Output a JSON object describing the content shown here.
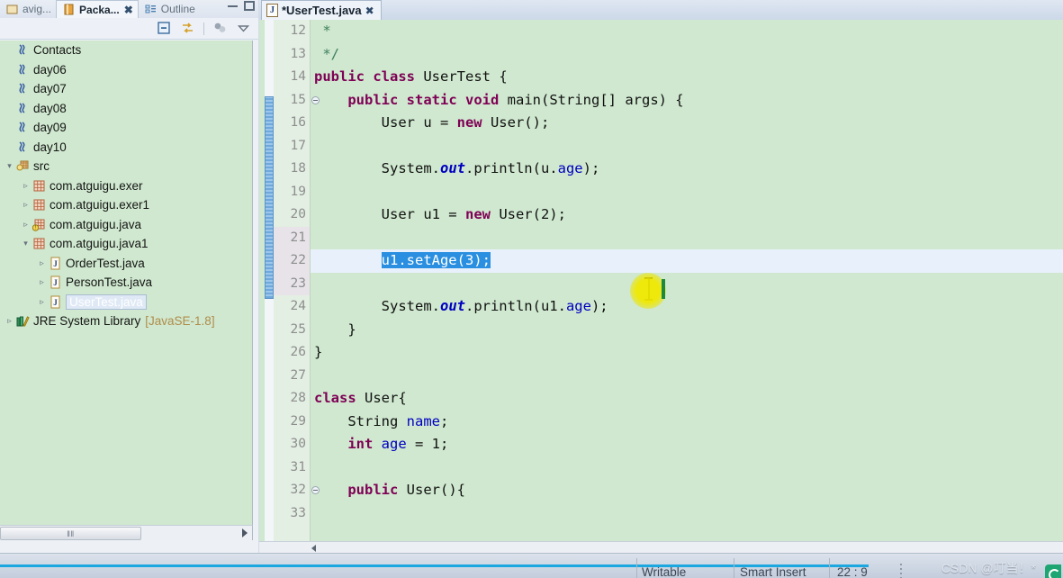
{
  "colors": {
    "tree_bg": "#cfe8cf",
    "editor_bg": "#cfe8cf",
    "selection": "#2a8fe0",
    "keyword": "#7f0055",
    "comment": "#3f7f5f",
    "field": "#0000c0",
    "current_line": "#e8f1fb",
    "accent_cyan": "#1ba8e0"
  },
  "left_panel": {
    "tabs": [
      {
        "label": "avig...",
        "icon": "navigator-icon",
        "active": false,
        "closable": false
      },
      {
        "label": "Packa...",
        "icon": "package-explorer-icon",
        "active": true,
        "closable": true,
        "close": "✖"
      },
      {
        "label": "Outline",
        "icon": "outline-icon",
        "active": false,
        "closable": false
      }
    ],
    "window_buttons": [
      {
        "name": "minimize-button",
        "glyph": "minimize-icon"
      },
      {
        "name": "maximize-button",
        "glyph": "maximize-icon"
      }
    ],
    "toolbar": [
      {
        "name": "collapse-all-icon",
        "title": "Collapse All"
      },
      {
        "name": "link-with-editor-icon",
        "title": "Link with Editor"
      },
      {
        "name": "view-filters-icon",
        "title": "View Menu"
      },
      {
        "name": "chevron-down-icon",
        "title": "View Menu"
      }
    ],
    "tree": [
      {
        "label": "Contacts",
        "indent": 0,
        "icon": "java-project-icon",
        "twisty": "",
        "selected": false,
        "suffix": ""
      },
      {
        "label": "day06",
        "indent": 0,
        "icon": "java-project-icon",
        "twisty": "",
        "selected": false,
        "suffix": ""
      },
      {
        "label": "day07",
        "indent": 0,
        "icon": "java-project-icon",
        "twisty": "",
        "selected": false,
        "suffix": ""
      },
      {
        "label": "day08",
        "indent": 0,
        "icon": "java-project-icon",
        "twisty": "",
        "selected": false,
        "suffix": ""
      },
      {
        "label": "day09",
        "indent": 0,
        "icon": "java-project-icon",
        "twisty": "",
        "selected": false,
        "suffix": ""
      },
      {
        "label": "day10",
        "indent": 0,
        "icon": "java-project-icon",
        "twisty": "",
        "selected": false,
        "suffix": ""
      },
      {
        "label": "src",
        "indent": 0,
        "icon": "source-folder-icon",
        "twisty": "▾",
        "selected": false,
        "suffix": ""
      },
      {
        "label": "com.atguigu.exer",
        "indent": 1,
        "icon": "package-icon",
        "twisty": "▹",
        "selected": false,
        "suffix": ""
      },
      {
        "label": "com.atguigu.exer1",
        "indent": 1,
        "icon": "package-icon",
        "twisty": "▹",
        "selected": false,
        "suffix": ""
      },
      {
        "label": "com.atguigu.java",
        "indent": 1,
        "icon": "package-warning-icon",
        "twisty": "▹",
        "selected": false,
        "suffix": ""
      },
      {
        "label": "com.atguigu.java1",
        "indent": 1,
        "icon": "package-icon",
        "twisty": "▾",
        "selected": false,
        "suffix": ""
      },
      {
        "label": "OrderTest.java",
        "indent": 2,
        "icon": "java-file-icon",
        "twisty": "▹",
        "selected": false,
        "suffix": ""
      },
      {
        "label": "PersonTest.java",
        "indent": 2,
        "icon": "java-file-icon",
        "twisty": "▹",
        "selected": false,
        "suffix": ""
      },
      {
        "label": "UserTest.java",
        "indent": 2,
        "icon": "java-file-icon",
        "twisty": "▹",
        "selected": true,
        "suffix": ""
      },
      {
        "label": "JRE System Library",
        "indent": 0,
        "icon": "library-icon",
        "twisty": "▹",
        "selected": false,
        "suffix": "[JavaSE-1.8]"
      }
    ],
    "hscrollbar": {
      "thumb_glyph": "‖‖",
      "right_arrow": "right-arrow-icon"
    }
  },
  "editor": {
    "tab": {
      "label": "*UserTest.java",
      "icon": "java-file-icon",
      "icon_letter": "J",
      "close": "✖",
      "dirty": true
    },
    "cursor_position": {
      "line": 22,
      "column": 9
    },
    "selection_text": "u1.setAge(3);",
    "lines": [
      {
        "no": 12,
        "fold": false,
        "near": false,
        "highlight": false,
        "tokens": [
          {
            "t": " *",
            "c": "cmt"
          }
        ]
      },
      {
        "no": 13,
        "fold": false,
        "near": false,
        "highlight": false,
        "tokens": [
          {
            "t": " */",
            "c": "cmt"
          }
        ]
      },
      {
        "no": 14,
        "fold": false,
        "near": false,
        "highlight": false,
        "tokens": [
          {
            "t": "public",
            "c": "kw"
          },
          {
            "t": " ",
            "c": ""
          },
          {
            "t": "class",
            "c": "kw"
          },
          {
            "t": " UserTest {",
            "c": ""
          }
        ]
      },
      {
        "no": 15,
        "fold": true,
        "near": false,
        "highlight": false,
        "tokens": [
          {
            "t": "    ",
            "c": ""
          },
          {
            "t": "public",
            "c": "kw"
          },
          {
            "t": " ",
            "c": ""
          },
          {
            "t": "static",
            "c": "kw"
          },
          {
            "t": " ",
            "c": ""
          },
          {
            "t": "void",
            "c": "kw"
          },
          {
            "t": " main(String[] args) {",
            "c": ""
          }
        ]
      },
      {
        "no": 16,
        "fold": false,
        "near": false,
        "highlight": false,
        "tokens": [
          {
            "t": "        User u = ",
            "c": ""
          },
          {
            "t": "new",
            "c": "kw"
          },
          {
            "t": " User();",
            "c": ""
          }
        ]
      },
      {
        "no": 17,
        "fold": false,
        "near": false,
        "highlight": false,
        "tokens": [
          {
            "t": "",
            "c": ""
          }
        ]
      },
      {
        "no": 18,
        "fold": false,
        "near": false,
        "highlight": false,
        "tokens": [
          {
            "t": "        System.",
            "c": ""
          },
          {
            "t": "out",
            "c": "stat"
          },
          {
            "t": ".println(u.",
            "c": ""
          },
          {
            "t": "age",
            "c": "fld"
          },
          {
            "t": ");",
            "c": ""
          }
        ]
      },
      {
        "no": 19,
        "fold": false,
        "near": false,
        "highlight": false,
        "tokens": [
          {
            "t": "",
            "c": ""
          }
        ]
      },
      {
        "no": 20,
        "fold": false,
        "near": false,
        "highlight": false,
        "tokens": [
          {
            "t": "        User u1 = ",
            "c": ""
          },
          {
            "t": "new",
            "c": "kw"
          },
          {
            "t": " User(2);",
            "c": ""
          }
        ]
      },
      {
        "no": 21,
        "fold": false,
        "near": true,
        "highlight": false,
        "tokens": [
          {
            "t": "",
            "c": ""
          }
        ]
      },
      {
        "no": 22,
        "fold": false,
        "near": true,
        "highlight": true,
        "tokens": [
          {
            "t": "        ",
            "c": ""
          },
          {
            "t": "u1.setAge(3);",
            "c": "sel"
          }
        ]
      },
      {
        "no": 23,
        "fold": false,
        "near": true,
        "highlight": false,
        "tokens": [
          {
            "t": "",
            "c": ""
          }
        ]
      },
      {
        "no": 24,
        "fold": false,
        "near": false,
        "highlight": false,
        "tokens": [
          {
            "t": "        System.",
            "c": ""
          },
          {
            "t": "out",
            "c": "stat"
          },
          {
            "t": ".println(u1.",
            "c": ""
          },
          {
            "t": "age",
            "c": "fld"
          },
          {
            "t": ");",
            "c": ""
          }
        ]
      },
      {
        "no": 25,
        "fold": false,
        "near": false,
        "highlight": false,
        "tokens": [
          {
            "t": "    }",
            "c": ""
          }
        ]
      },
      {
        "no": 26,
        "fold": false,
        "near": false,
        "highlight": false,
        "tokens": [
          {
            "t": "}",
            "c": ""
          }
        ]
      },
      {
        "no": 27,
        "fold": false,
        "near": false,
        "highlight": false,
        "tokens": [
          {
            "t": "",
            "c": ""
          }
        ]
      },
      {
        "no": 28,
        "fold": false,
        "near": false,
        "highlight": false,
        "tokens": [
          {
            "t": "class",
            "c": "kw"
          },
          {
            "t": " User{",
            "c": ""
          }
        ]
      },
      {
        "no": 29,
        "fold": false,
        "near": false,
        "highlight": false,
        "tokens": [
          {
            "t": "    String ",
            "c": ""
          },
          {
            "t": "name",
            "c": "fld"
          },
          {
            "t": ";",
            "c": ""
          }
        ]
      },
      {
        "no": 30,
        "fold": false,
        "near": false,
        "highlight": false,
        "tokens": [
          {
            "t": "    ",
            "c": ""
          },
          {
            "t": "int",
            "c": "kw"
          },
          {
            "t": " ",
            "c": ""
          },
          {
            "t": "age",
            "c": "fld"
          },
          {
            "t": " = 1;",
            "c": ""
          }
        ]
      },
      {
        "no": 31,
        "fold": false,
        "near": false,
        "highlight": false,
        "tokens": [
          {
            "t": "",
            "c": ""
          }
        ]
      },
      {
        "no": 32,
        "fold": true,
        "near": false,
        "highlight": false,
        "tokens": [
          {
            "t": "    ",
            "c": ""
          },
          {
            "t": "public",
            "c": "kw"
          },
          {
            "t": " User(){",
            "c": ""
          }
        ]
      },
      {
        "no": 33,
        "fold": false,
        "near": false,
        "highlight": false,
        "tokens": [
          {
            "t": "",
            "c": ""
          }
        ]
      }
    ],
    "hscrollbar": {
      "left_arrow": "left-arrow-icon"
    }
  },
  "statusbar": {
    "writable": "Writable",
    "insert_mode": "Smart Insert",
    "position": "22 : 9",
    "watermark": "CSDN @叮当！*"
  }
}
